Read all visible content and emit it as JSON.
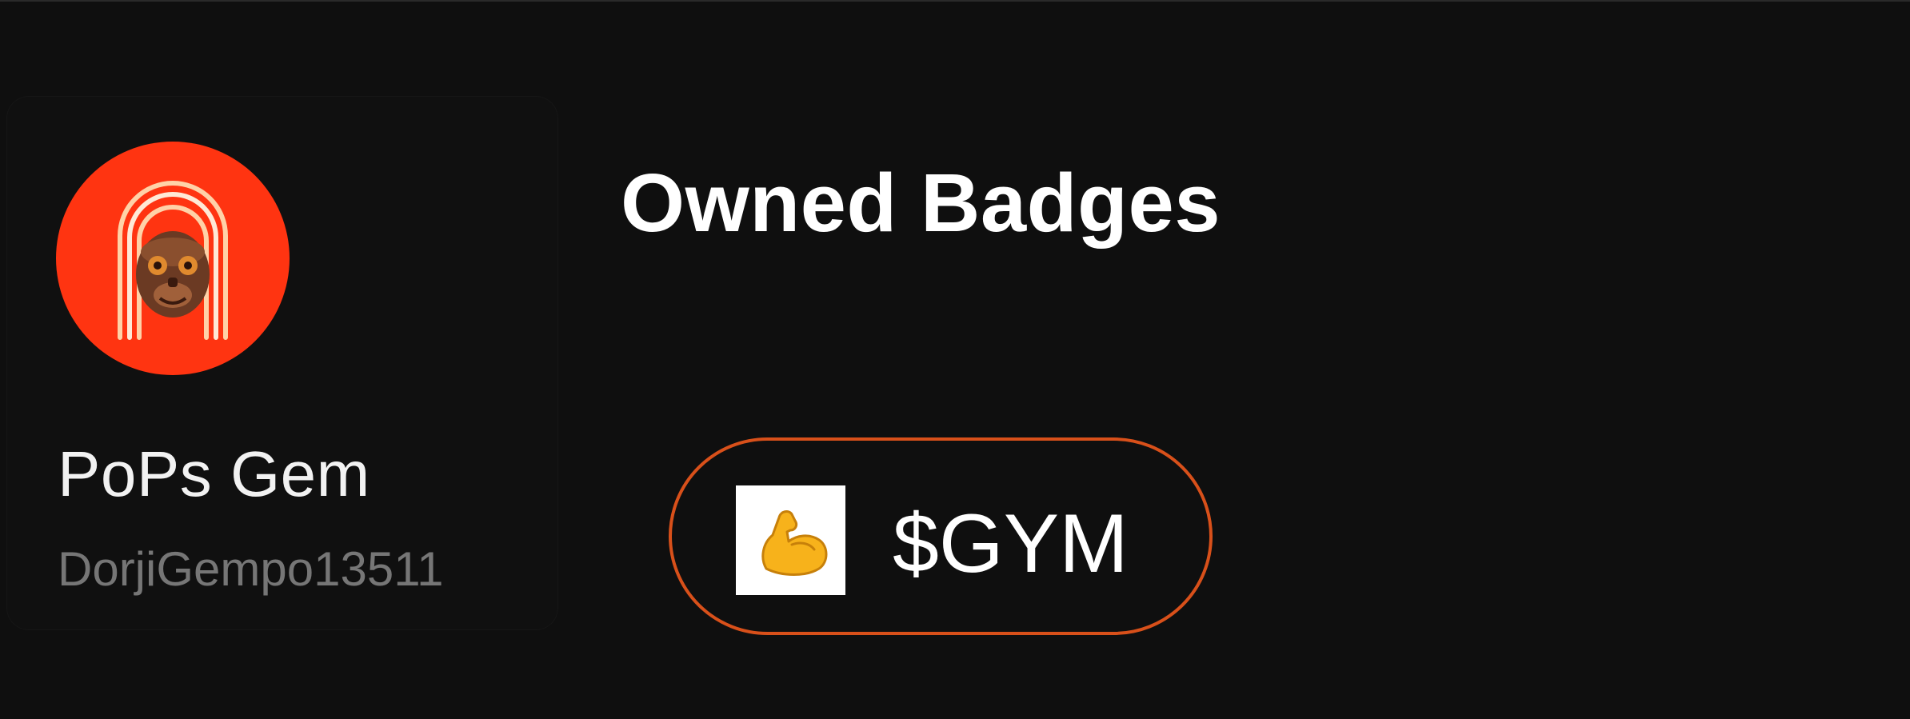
{
  "profile": {
    "display_name": "PoPs Gem",
    "username": "DorjiGempo13511",
    "avatar_icon": "monkey-mask-arches-icon",
    "avatar_bg": "#ff3411"
  },
  "badges_section": {
    "title": "Owned Badges",
    "badges": [
      {
        "label": "$GYM",
        "icon": "flexed-biceps-icon",
        "border_color": "#d8501a"
      }
    ]
  }
}
